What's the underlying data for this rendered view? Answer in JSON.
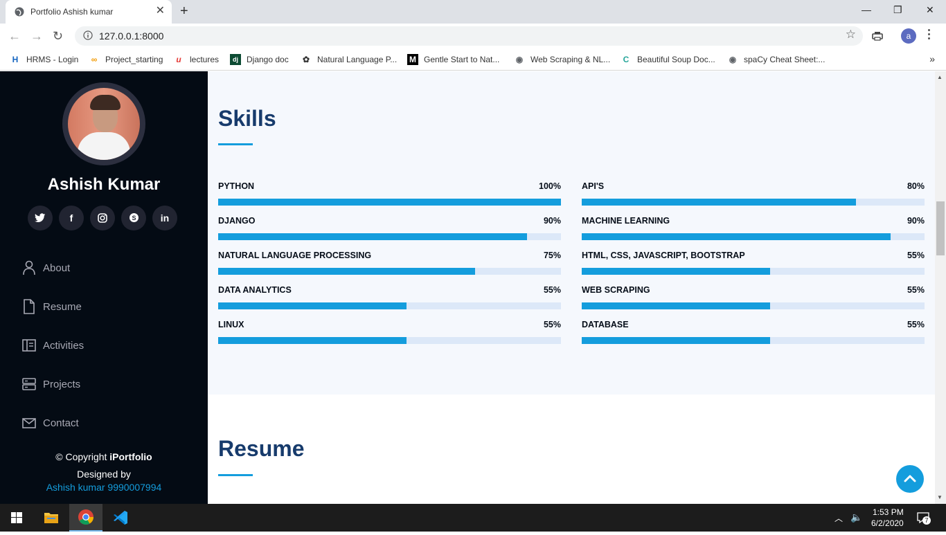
{
  "browser": {
    "tab_title": "Portfolio Ashish kumar",
    "tab_close": "✕",
    "new_tab": "+",
    "url": "127.0.0.1:8000",
    "profile_initial": "a",
    "window_controls": {
      "minimize": "—",
      "restore": "❐",
      "close": "✕"
    },
    "bookmarks": [
      {
        "label": "HRMS - Login",
        "icon": "hrms-icon",
        "glyph": "H",
        "color": "#1565c0"
      },
      {
        "label": "Project_starting",
        "icon": "project-icon",
        "glyph": "∞",
        "color": "#f29900"
      },
      {
        "label": "lectures",
        "icon": "lectures-icon",
        "glyph": "u",
        "color": "#e53935"
      },
      {
        "label": "Django doc",
        "icon": "django-icon",
        "glyph": "dj",
        "color": "#0c4b33"
      },
      {
        "label": "Natural Language P...",
        "icon": "nlp-icon",
        "glyph": "✿",
        "color": "#333333"
      },
      {
        "label": "Gentle Start to Nat...",
        "icon": "medium-icon",
        "glyph": "M",
        "color": "#000000"
      },
      {
        "label": "Web Scraping & NL...",
        "icon": "globe-icon",
        "glyph": "◉",
        "color": "#5f6368"
      },
      {
        "label": "Beautiful Soup Doc...",
        "icon": "c-icon",
        "glyph": "C",
        "color": "#26a69a"
      },
      {
        "label": "spaCy Cheat Sheet:...",
        "icon": "globe-icon",
        "glyph": "◉",
        "color": "#5f6368"
      }
    ],
    "bookmarks_more": "»"
  },
  "sidebar": {
    "name": "Ashish Kumar",
    "socials": [
      {
        "icon": "twitter-icon",
        "glyph": "🐦"
      },
      {
        "icon": "facebook-icon",
        "glyph": "f"
      },
      {
        "icon": "instagram-icon",
        "glyph": "◎"
      },
      {
        "icon": "skype-icon",
        "glyph": "S"
      },
      {
        "icon": "linkedin-icon",
        "glyph": "in"
      }
    ],
    "nav": [
      {
        "label": "About",
        "icon": "user-icon"
      },
      {
        "label": "Resume",
        "icon": "file-icon"
      },
      {
        "label": "Activities",
        "icon": "book-icon"
      },
      {
        "label": "Projects",
        "icon": "server-icon"
      },
      {
        "label": "Contact",
        "icon": "envelope-icon"
      }
    ],
    "copyright_prefix": "© Copyright ",
    "copyright_brand": "iPortfolio",
    "designed_by": "Designed by",
    "designer": "Ashish kumar 9990007994"
  },
  "skills": {
    "title": "Skills",
    "items": [
      {
        "name": "PYTHON",
        "label": "100%",
        "value": 100
      },
      {
        "name": "API'S",
        "label": "80%",
        "value": 80
      },
      {
        "name": "DJANGO",
        "label": "90%",
        "value": 90
      },
      {
        "name": "MACHINE LEARNING",
        "label": "90%",
        "value": 90
      },
      {
        "name": "NATURAL LANGUAGE PROCESSING",
        "label": "75%",
        "value": 75
      },
      {
        "name": "HTML, CSS, JAVASCRIPT, BOOTSTRAP",
        "label": "55%",
        "value": 55
      },
      {
        "name": "DATA ANALYTICS",
        "label": "55%",
        "value": 55
      },
      {
        "name": "WEB SCRAPING",
        "label": "55%",
        "value": 55
      },
      {
        "name": "LINUX",
        "label": "55%",
        "value": 55
      },
      {
        "name": "DATABASE",
        "label": "55%",
        "value": 55
      }
    ]
  },
  "resume": {
    "title": "Resume"
  },
  "taskbar": {
    "time": "1:53 PM",
    "date": "6/2/2020",
    "notification_count": "7"
  },
  "colors": {
    "accent": "#149ddd",
    "heading": "#173b6c",
    "sidebar_bg": "#040b14",
    "section_bg": "#f5f8fd"
  }
}
